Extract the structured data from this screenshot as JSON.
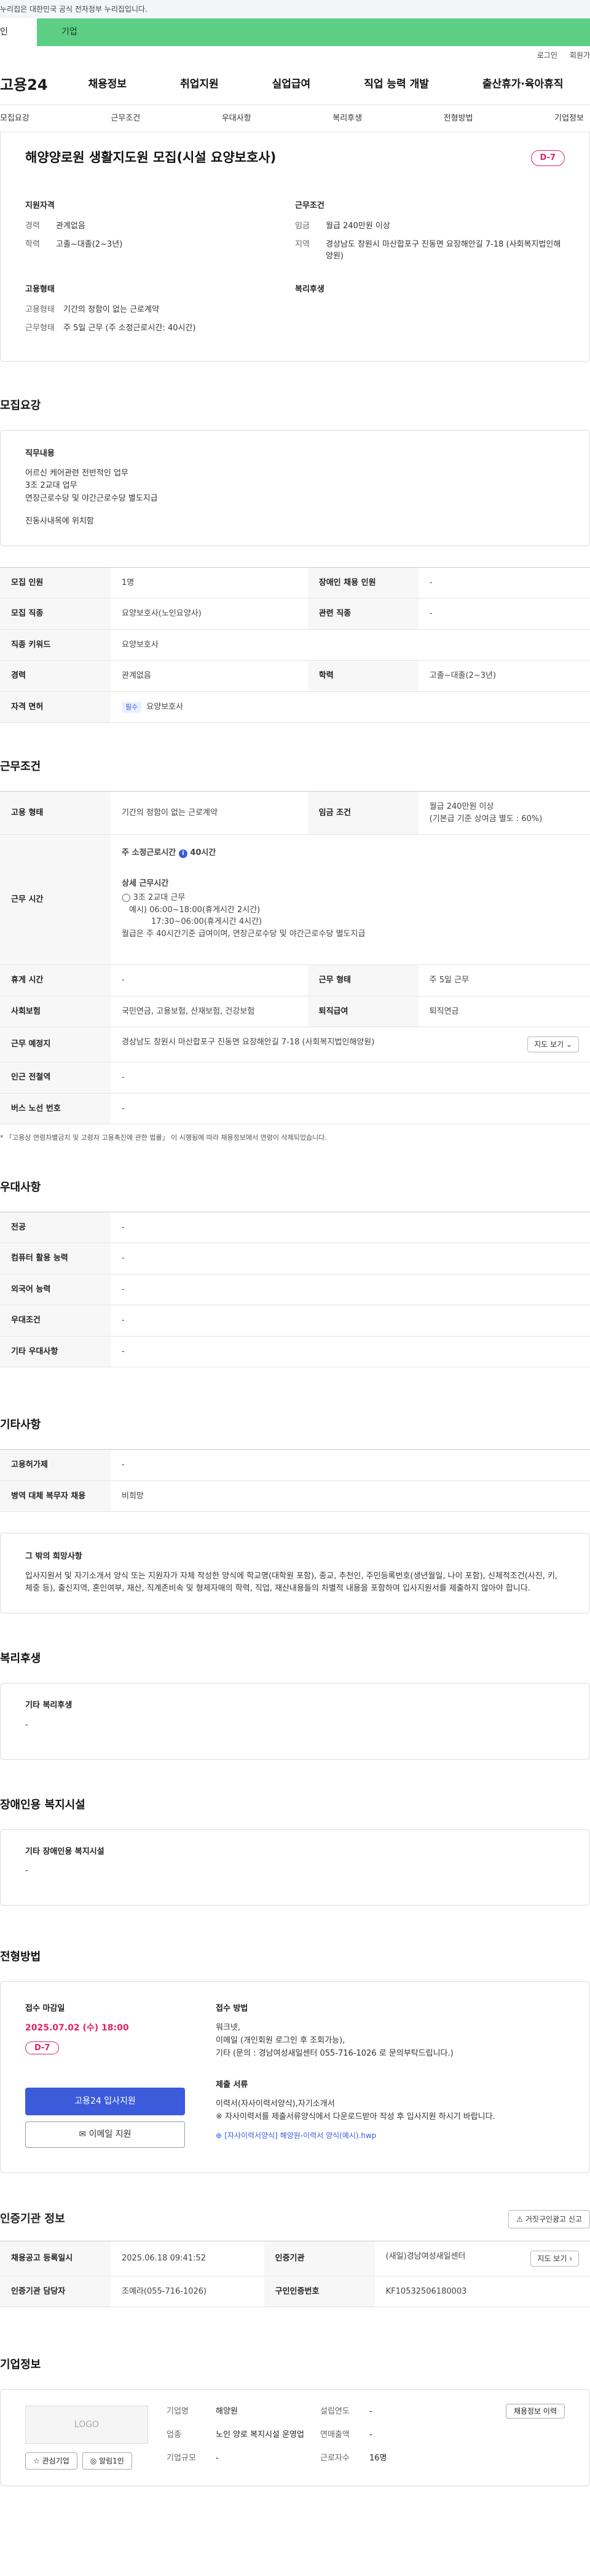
{
  "gov_notice": "누리집은 대한민국 공식 전자정부 누리집입니다.",
  "role_tabs": {
    "individual": "인",
    "business": "기업"
  },
  "util": {
    "login": "로그인",
    "signup": "회원가"
  },
  "logo": "고용24",
  "gnb": [
    "채용정보",
    "취업지원",
    "실업급여",
    "직업 능력 개발",
    "출산휴가·육아휴직"
  ],
  "lnb": [
    "모집요강",
    "근무조건",
    "우대사항",
    "복리후생",
    "전형방법",
    "기업정보"
  ],
  "title": "해양양로원 생활지도원 모집(시설 요양보호사)",
  "dday": "D-7",
  "summary": {
    "qual_head": "지원자격",
    "career_label": "경력",
    "career": "관계없음",
    "edu_label": "학력",
    "edu": "고졸~대졸(2~3년)",
    "cond_head": "근무조건",
    "wage_label": "임금",
    "wage": "월급 240만원 이상",
    "region_label": "지역",
    "region": "경상남도 창원시 마산합포구 진동면 요장해안길 7-18 (사회복지법인해양원)",
    "emp_head": "고용형태",
    "emptype_label": "고용형태",
    "emptype": "기간의 정함이 없는 근로계약",
    "worktype_label": "근무형태",
    "worktype": "주 5일 근무 (주 소정근로시간: 40시간)",
    "welfare_head": "복리후생"
  },
  "recruit": {
    "section": "모집요강",
    "duty_head": "직무내용",
    "duty_lines": [
      "어르신 케어관련 전반적인 업무",
      "3조 2교대 업무",
      "연장근로수당 및 야간근로수당 별도지급",
      "",
      "진동사내목에 위치함"
    ],
    "rows": [
      {
        "k1": "모집 인원",
        "v1": "1명",
        "k2": "장애인 채용 인원",
        "v2": "-"
      },
      {
        "k1": "모집 직종",
        "v1": "요양보호사(노인요양사)",
        "k2": "관련 직종",
        "v2": "-"
      },
      {
        "k1": "직종 키워드",
        "v1": "요양보호사"
      },
      {
        "k1": "경력",
        "v1": "관계없음",
        "k2": "학력",
        "v2": "고졸~대졸(2~3년)"
      },
      {
        "k1": "자격 면허",
        "tag": "필수",
        "v1": "요양보호사"
      }
    ]
  },
  "work": {
    "section": "근무조건",
    "emp_type_label": "고용 형태",
    "emp_type": "기간의 정함이 없는 근로계약",
    "wage_label": "임금 조건",
    "wage": "월급 240만원 이상",
    "wage_note": "(기본급 기준 상여금 별도 : 60%)",
    "hours_label": "근무 시간",
    "hours_total": "주 소정근로시간",
    "hours_total_val": "40시간",
    "hours_detail_head": "상세 근무시간",
    "hours_lines": [
      "◯ 3조 2교대 근무",
      "예시) 06:00~18:00(휴게시간 2시간)",
      "17:30~06:00(휴게시간 4시간)",
      "월급은 주 40시간기준 급여이며, 연장근로수당 및 야간근로수당 별도지급"
    ],
    "rest_label": "휴게 시간",
    "rest": "-",
    "form_label": "근무 형태",
    "form": "주 5일 근무",
    "ins_label": "사회보험",
    "ins": "국민연금, 고용보험, 산재보험, 건강보험",
    "ret_label": "퇴직급여",
    "ret": "퇴직연금",
    "place_label": "근무 예정지",
    "place": "경상남도 창원시 마산합포구 진동면 요장해안길 7-18 (사회복지법인해양원)",
    "map_btn": "지도 보기",
    "subway_label": "인근 전철역",
    "subway": "-",
    "bus_label": "버스 노선 번호",
    "bus": "-",
    "note": "* 「고용상 연령차별금지 및 고령자 고용촉진에 관한 법률」 이 시행됨에 따라 채용정보에서 연령이 삭제되었습니다."
  },
  "pref": {
    "section": "우대사항",
    "rows": [
      {
        "k": "전공",
        "v": "-"
      },
      {
        "k": "컴퓨터 활용 능력",
        "v": "-"
      },
      {
        "k": "외국어 능력",
        "v": "-"
      },
      {
        "k": "우대조건",
        "v": "-"
      },
      {
        "k": "기타 우대사항",
        "v": "-"
      }
    ]
  },
  "etc": {
    "section": "기타사항",
    "rows": [
      {
        "k": "고용허가제",
        "v": "-"
      },
      {
        "k": "병역 대체 복무자 채용",
        "v": "비희망"
      }
    ],
    "other_head": "그 밖의 희망사항",
    "other_text": "입사지원서 및 자기소개서 양식 또는 지원자가 자체 작성한 양식에 학교명(대학원 포함), 종교, 추천인, 주민등록번호(생년월일, 나이 포함), 신체적조건(사진, 키, 체중 등), 출신지역, 혼인여부, 재산, 직계존비속 및 형제자매의 학력, 직업, 재산내용들의 차별적 내용을 포함하여 입사지원서를 제출하지 않아야 합니다."
  },
  "welfare": {
    "section": "복리후생",
    "head": "기타 복리후생",
    "val": "-"
  },
  "disabled": {
    "section": "장애인용 복지시설",
    "head": "기타 장애인용 복지시설",
    "val": "-"
  },
  "apply": {
    "section": "전형방법",
    "deadline_head": "접수 마감일",
    "deadline": "2025.07.02 (수) 18:00",
    "dday": "D-7",
    "main_btn": "고용24 입사지원",
    "email_btn": "이메일 지원",
    "method_head": "접수 방법",
    "method_lines": [
      "워크넷,",
      "이메일 (개인회원 로그인 후 조회가능),",
      "기타 (문의 : 경남여성새일센터 055-716-1026 로 문의부탁드립니다.)"
    ],
    "docs_head": "제출 서류",
    "docs_lines": [
      "이력서(자사이력서양식),자기소개서",
      "※ 자사이력서를 제출서류양식에서 다운로드받아 작성 후 입사지원 하시기 바랍니다."
    ],
    "docs_link": "[자사이력서양식] 해양원-이력서 양식(예시).hwp"
  },
  "cert": {
    "section": "인증기관 정보",
    "report_btn": "거짓구인광고 신고",
    "reg_label": "채용공고 등록일시",
    "reg": "2025.06.18 09:41:52",
    "org_label": "인증기관",
    "org": "(새일)경남여성새일센터",
    "map_btn": "지도 보기",
    "mgr_label": "인증기관 담당자",
    "mgr": "조예라(055-716-1026)",
    "no_label": "구인인증번호",
    "no": "KF10532506180003"
  },
  "company": {
    "section": "기업정보",
    "logo_text": "LOGO",
    "fav_btn": "관심기업",
    "alert_btn": "알림1인",
    "name_label": "기업명",
    "name": "해양원",
    "year_label": "설립연도",
    "year": "-",
    "hire_btn": "채용정보 이력",
    "industry_label": "업종",
    "industry": "노인 양로 복지시설 운영업",
    "sales_label": "연매출액",
    "sales": "-",
    "staff_label": "근로자수",
    "staff": "16명",
    "size_label": "기업규모",
    "size": "-"
  }
}
